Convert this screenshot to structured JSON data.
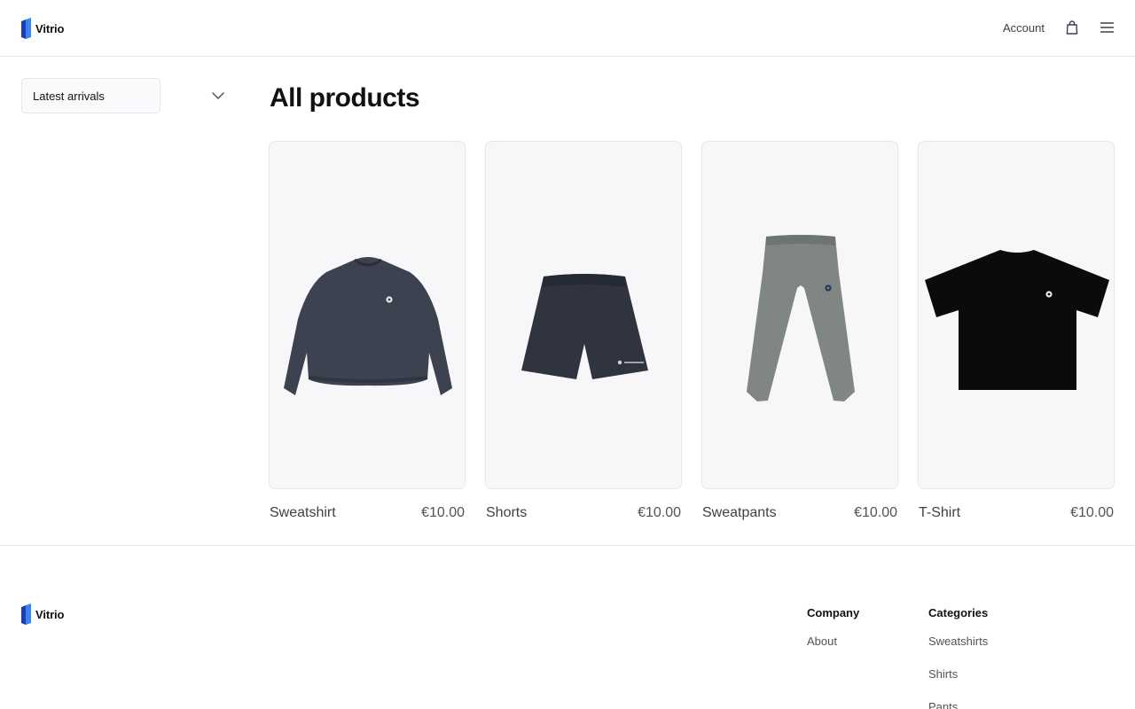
{
  "brand": {
    "name": "Vitrio",
    "logo_icon": "vitrio-logo-icon",
    "accent": "#2563eb"
  },
  "header": {
    "account_label": "Account",
    "cart_icon": "shopping-bag-icon",
    "menu_icon": "hamburger-menu-icon"
  },
  "sort": {
    "selected": "Latest arrivals",
    "icon": "chevron-down-icon"
  },
  "page": {
    "title": "All products"
  },
  "products": [
    {
      "name": "Sweatshirt",
      "price": "€10.00",
      "image": "sweatshirt-image"
    },
    {
      "name": "Shorts",
      "price": "€10.00",
      "image": "shorts-image"
    },
    {
      "name": "Sweatpants",
      "price": "€10.00",
      "image": "sweatpants-image"
    },
    {
      "name": "T-Shirt",
      "price": "€10.00",
      "image": "tshirt-image"
    }
  ],
  "footer": {
    "brand_name": "Vitrio",
    "company": {
      "title": "Company",
      "links": [
        "About"
      ]
    },
    "categories": {
      "title": "Categories",
      "links": [
        "Sweatshirts",
        "Shirts",
        "Pants"
      ]
    }
  }
}
